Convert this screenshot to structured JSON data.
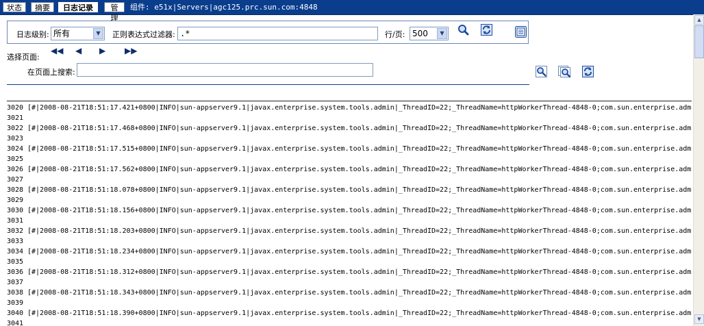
{
  "tabs": [
    {
      "label": "状态"
    },
    {
      "label": "摘要"
    },
    {
      "label": "日志记录"
    },
    {
      "label": "管理"
    }
  ],
  "component_path": "组件: e51x|Servers|agc125.prc.sun.com:4848",
  "filter": {
    "level_label": "日志级别:",
    "level_value": "所有",
    "regex_label": "正则表达式过滤器:",
    "regex_value": ".*",
    "rows_label": "行/页:",
    "rows_value": "500"
  },
  "navigation": {
    "select_page_label": "选择页面:",
    "first": "◀◀",
    "prev": "◀",
    "next": "▶",
    "last": "▶▶",
    "search_label": "在页面上搜索:",
    "search_value": ""
  },
  "log_lines": [
    {
      "n": "3020",
      "text": "[#|2008-08-21T18:51:17.421+0800|INFO|sun-appserver9.1|javax.enterprise.system.tools.admin|_ThreadID=22;_ThreadName=httpWorkerThread-4848-0;com.sun.enterprise.admi"
    },
    {
      "n": "3021",
      "text": ""
    },
    {
      "n": "3022",
      "text": "[#|2008-08-21T18:51:17.468+0800|INFO|sun-appserver9.1|javax.enterprise.system.tools.admin|_ThreadID=22;_ThreadName=httpWorkerThread-4848-0;com.sun.enterprise.admi"
    },
    {
      "n": "3023",
      "text": ""
    },
    {
      "n": "3024",
      "text": "[#|2008-08-21T18:51:17.515+0800|INFO|sun-appserver9.1|javax.enterprise.system.tools.admin|_ThreadID=22;_ThreadName=httpWorkerThread-4848-0;com.sun.enterprise.admi"
    },
    {
      "n": "3025",
      "text": ""
    },
    {
      "n": "3026",
      "text": "[#|2008-08-21T18:51:17.562+0800|INFO|sun-appserver9.1|javax.enterprise.system.tools.admin|_ThreadID=22;_ThreadName=httpWorkerThread-4848-0;com.sun.enterprise.admi"
    },
    {
      "n": "3027",
      "text": ""
    },
    {
      "n": "3028",
      "text": "[#|2008-08-21T18:51:18.078+0800|INFO|sun-appserver9.1|javax.enterprise.system.tools.admin|_ThreadID=22;_ThreadName=httpWorkerThread-4848-0;com.sun.enterprise.admi"
    },
    {
      "n": "3029",
      "text": ""
    },
    {
      "n": "3030",
      "text": "[#|2008-08-21T18:51:18.156+0800|INFO|sun-appserver9.1|javax.enterprise.system.tools.admin|_ThreadID=22;_ThreadName=httpWorkerThread-4848-0;com.sun.enterprise.admi"
    },
    {
      "n": "3031",
      "text": ""
    },
    {
      "n": "3032",
      "text": "[#|2008-08-21T18:51:18.203+0800|INFO|sun-appserver9.1|javax.enterprise.system.tools.admin|_ThreadID=22;_ThreadName=httpWorkerThread-4848-0;com.sun.enterprise.admi"
    },
    {
      "n": "3033",
      "text": ""
    },
    {
      "n": "3034",
      "text": "[#|2008-08-21T18:51:18.234+0800|INFO|sun-appserver9.1|javax.enterprise.system.tools.admin|_ThreadID=22;_ThreadName=httpWorkerThread-4848-0;com.sun.enterprise.admi"
    },
    {
      "n": "3035",
      "text": ""
    },
    {
      "n": "3036",
      "text": "[#|2008-08-21T18:51:18.312+0800|INFO|sun-appserver9.1|javax.enterprise.system.tools.admin|_ThreadID=22;_ThreadName=httpWorkerThread-4848-0;com.sun.enterprise.admi"
    },
    {
      "n": "3037",
      "text": ""
    },
    {
      "n": "3038",
      "text": "[#|2008-08-21T18:51:18.343+0800|INFO|sun-appserver9.1|javax.enterprise.system.tools.admin|_ThreadID=22;_ThreadName=httpWorkerThread-4848-0;com.sun.enterprise.admi"
    },
    {
      "n": "3039",
      "text": ""
    },
    {
      "n": "3040",
      "text": "[#|2008-08-21T18:51:18.390+0800|INFO|sun-appserver9.1|javax.enterprise.system.tools.admin|_ThreadID=22;_ThreadName=httpWorkerThread-4848-0;com.sun.enterprise.admi"
    },
    {
      "n": "3041",
      "text": ""
    }
  ],
  "colors": {
    "tabbar": "#0a3d8c",
    "accent": "#6b87b8"
  },
  "icons": [
    "search-icon",
    "refresh-icon",
    "export-icon",
    "find-icon",
    "find-next-icon",
    "reload-icon"
  ]
}
